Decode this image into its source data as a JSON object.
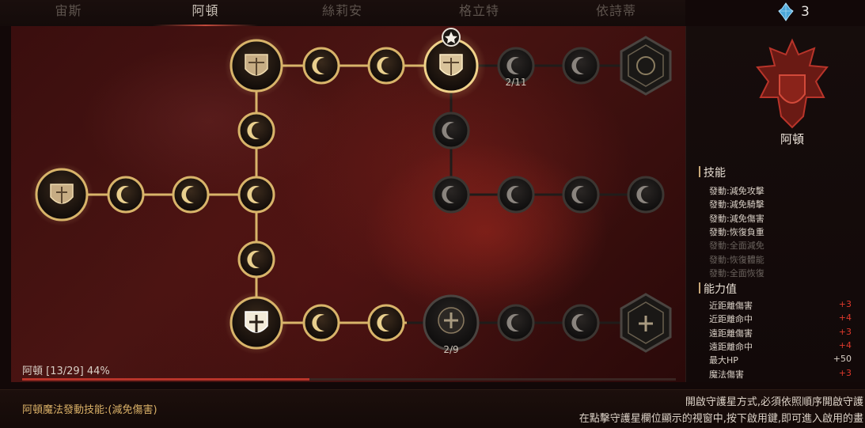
{
  "tabs": [
    "宙斯",
    "阿頓",
    "絲莉安",
    "格立特",
    "依詩蒂"
  ],
  "active_tab": 1,
  "gem_count": "3",
  "tree": {
    "progress_label": "阿頓 [13/29] 44%",
    "progress": 0.44,
    "node_counters": [
      "2/11",
      "2/9"
    ]
  },
  "side": {
    "crest_name": "阿頓",
    "skills_title": "技能",
    "skills": [
      {
        "label": "發動:減免攻擊",
        "active": true
      },
      {
        "label": "發動:減免騎擊",
        "active": true
      },
      {
        "label": "發動:減免傷害",
        "active": true
      },
      {
        "label": "發動:恢復負重",
        "active": true
      },
      {
        "label": "發動:全面減免",
        "active": false
      },
      {
        "label": "發動:恢復體能",
        "active": false
      },
      {
        "label": "發動:全面恢復",
        "active": false
      }
    ],
    "stats_title": "能力值",
    "stats": [
      {
        "label": "近距離傷害",
        "value": "+3"
      },
      {
        "label": "近距離命中",
        "value": "+4"
      },
      {
        "label": "遠距離傷害",
        "value": "+3"
      },
      {
        "label": "遠距離命中",
        "value": "+4"
      },
      {
        "label": "最大HP",
        "value": "+50"
      },
      {
        "label": "魔法傷害",
        "value": "+3"
      }
    ]
  },
  "bottom": {
    "left_text": "阿頓魔法發動技能:(減免傷害)",
    "right_line1": "開啟守護星方式,必須依照順序開啟守護",
    "right_line2": "在點擊守護星欄位顯示的視窗中,按下啟用鍵,即可進入啟用的畫"
  },
  "colors": {
    "accent": "#c24a3c",
    "gold": "#d8b46a",
    "stat_plus": "#e0392c"
  }
}
